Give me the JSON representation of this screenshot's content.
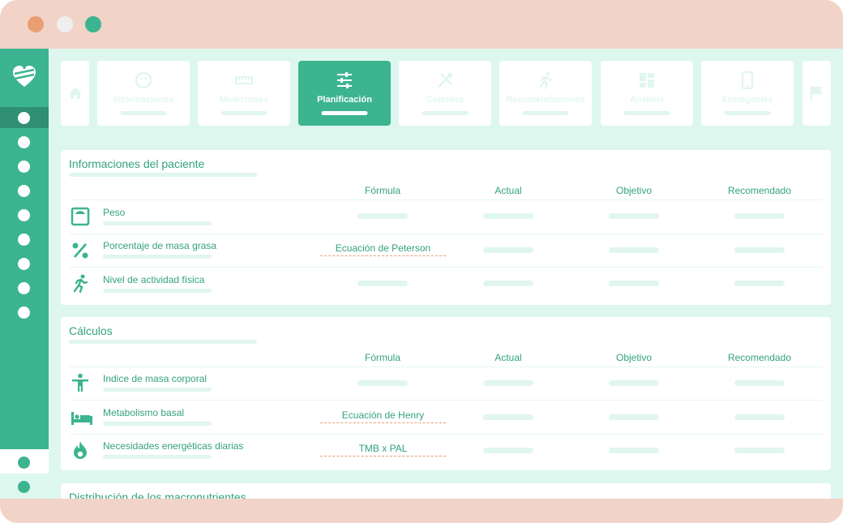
{
  "window": {
    "controls": [
      "close",
      "minimize",
      "maximize"
    ],
    "colors": {
      "frame": "#f2d3c8",
      "accent": "#3cb48f",
      "close": "#e99e73",
      "background": "#def7ee"
    }
  },
  "sidebar": {
    "logo": "heart-logo-icon"
  },
  "tabs": [
    {
      "label": "",
      "icon": "home-icon"
    },
    {
      "label": "Informaciones",
      "icon": "smile-icon"
    },
    {
      "label": "Mediciones",
      "icon": "ruler-icon"
    },
    {
      "label": "Planificación",
      "icon": "sliders-icon",
      "active": true
    },
    {
      "label": "Comidas",
      "icon": "utensils-icon"
    },
    {
      "label": "Recomendaciones",
      "icon": "running-icon"
    },
    {
      "label": "Análisis",
      "icon": "dashboard-icon"
    },
    {
      "label": "Entregables",
      "icon": "phone-icon"
    },
    {
      "label": "",
      "icon": "flag-icon"
    }
  ],
  "patient_info": {
    "title": "Informaciones del paciente",
    "columns": [
      "Fórmula",
      "Actual",
      "Objetivo",
      "Recomendado"
    ],
    "rows": [
      {
        "label": "Peso",
        "icon": "scale-icon",
        "formula": ""
      },
      {
        "label": "Porcentaje de masa grasa",
        "icon": "percent-icon",
        "formula": "Ecuación de Peterson"
      },
      {
        "label": "Nivel de actividad física",
        "icon": "running-icon",
        "formula": ""
      }
    ]
  },
  "calculations": {
    "title": "Cálculos",
    "columns": [
      "Fórmula",
      "Actual",
      "Objetivo",
      "Recomendado"
    ],
    "rows": [
      {
        "label": "Indice de masa corporal",
        "icon": "person-icon",
        "formula": ""
      },
      {
        "label": "Metabolismo basal",
        "icon": "bed-icon",
        "formula": "Ecuación de Henry"
      },
      {
        "label": "Necesidades energéticas diarias",
        "icon": "flame-icon",
        "formula": "TMB x PAL"
      }
    ]
  },
  "macronutrients": {
    "title": "Distribución de los macronutrientes"
  }
}
